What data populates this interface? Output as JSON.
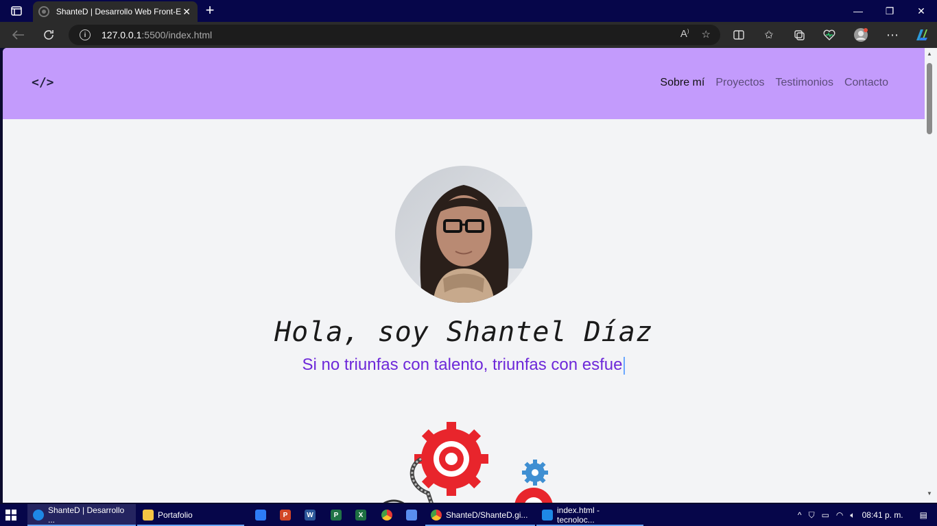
{
  "browser": {
    "tab_title": "ShanteD | Desarrollo Web Front-End",
    "tab_close": "✕",
    "new_tab": "+",
    "url_host": "127.0.0.1",
    "url_path": ":5500/index.html",
    "window_controls": [
      "—",
      "❐",
      "✕"
    ]
  },
  "site": {
    "logo": "</>",
    "nav": [
      {
        "label": "Sobre mí",
        "active": true
      },
      {
        "label": "Proyectos",
        "active": false
      },
      {
        "label": "Testimonios",
        "active": false
      },
      {
        "label": "Contacto",
        "active": false
      }
    ],
    "hero_name": "Hola, soy Shantel Díaz",
    "hero_tagline": "Si no triunfas con talento, triunfas con esfue"
  },
  "taskbar": {
    "apps": [
      {
        "label": "ShanteD | Desarrollo ...",
        "icon": "edge-icon",
        "color": "#1e88e5"
      },
      {
        "label": "Portafolio",
        "icon": "folder-icon",
        "color": "#f6c544"
      },
      {
        "label": "ShanteD/ShanteD.gi...",
        "icon": "chrome-icon",
        "color": "#e53935"
      },
      {
        "label": "index.html - tecnoloc...",
        "icon": "vscode-icon",
        "color": "#1e88e5"
      }
    ],
    "pinned": [
      {
        "icon": "store-icon",
        "color": "#2d7cf6",
        "text": ""
      },
      {
        "icon": "powerpoint-icon",
        "color": "#d24726",
        "text": "P"
      },
      {
        "icon": "word-icon",
        "color": "#2b579a",
        "text": "W"
      },
      {
        "icon": "project-icon",
        "color": "#217346",
        "text": "P"
      },
      {
        "icon": "excel-icon",
        "color": "#1d6f42",
        "text": "X"
      },
      {
        "icon": "chrome-pinned-icon",
        "color": "#e53935",
        "text": ""
      },
      {
        "icon": "keyboard-icon",
        "color": "#5a8dee",
        "text": ""
      }
    ],
    "clock": "08:41 p. m.",
    "tray_up": "^"
  }
}
